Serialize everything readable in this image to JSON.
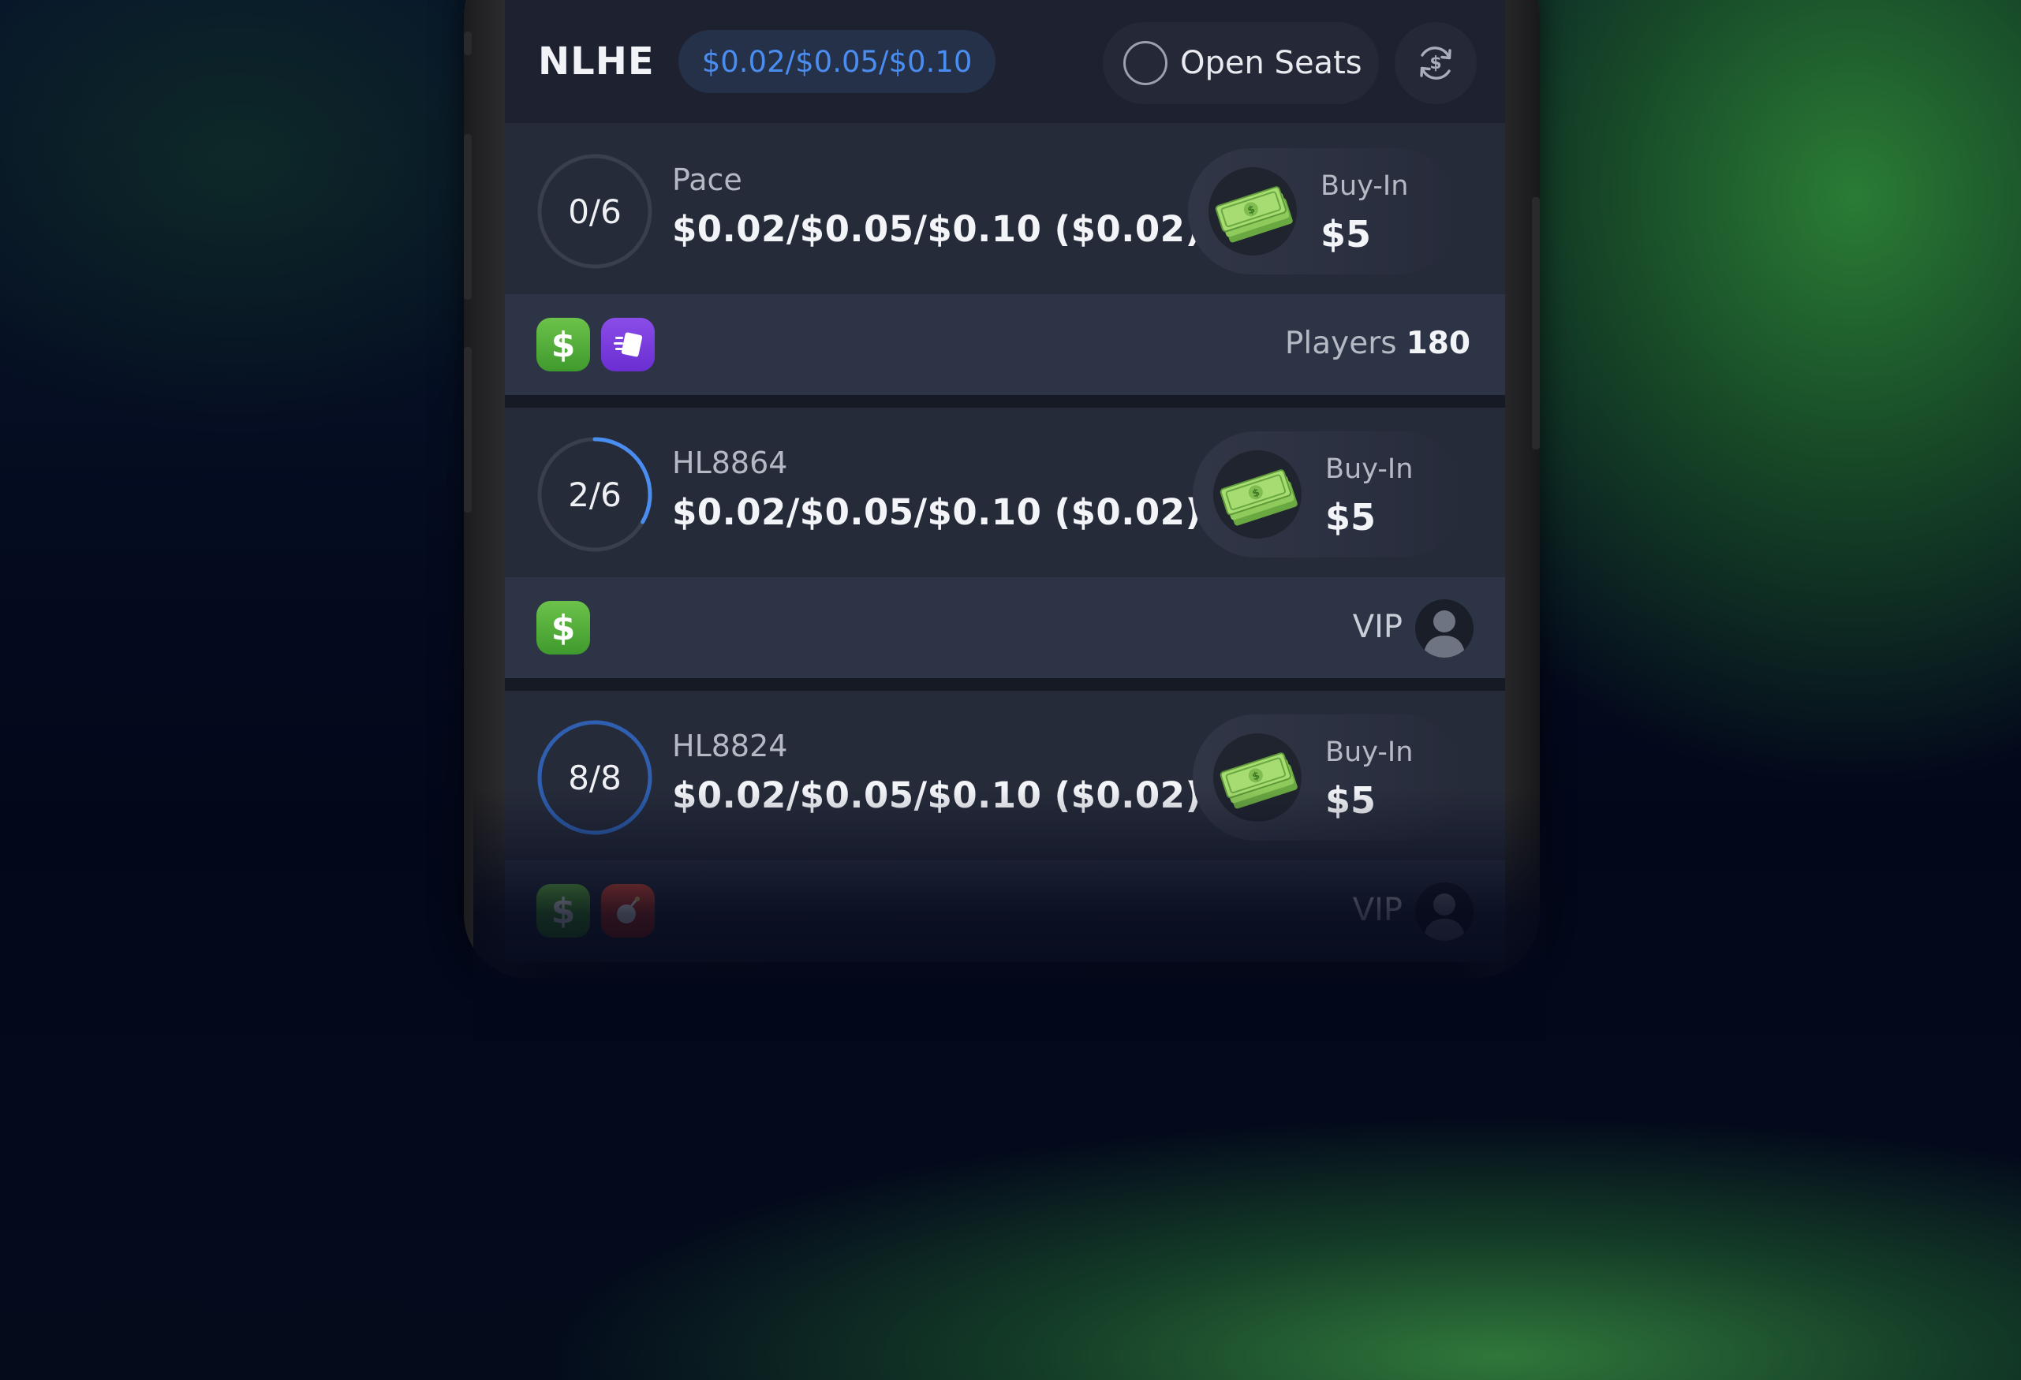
{
  "header": {
    "game": "NLHE",
    "stakes": "$0.02/$0.05/$0.10",
    "open_seats_label": "Open Seats",
    "currency_icon": "dollar-refresh-icon"
  },
  "tables": [
    {
      "seats": "0/6",
      "seat_fill": 0,
      "name": "Pace",
      "stakes": "$0.02/$0.05/$0.10 ($0.02)",
      "buyin_label": "Buy-In",
      "buyin_value": "$5",
      "badges": [
        "cash-badge-icon",
        "fast-fold-icon"
      ],
      "players_label": "Players",
      "players_count": "180"
    },
    {
      "seats": "2/6",
      "seat_fill": 0.333,
      "name": "HL8864",
      "stakes": "$0.02/$0.05/$0.10 ($0.02)",
      "buyin_label": "Buy-In",
      "buyin_value": "$5",
      "badges": [
        "cash-badge-icon"
      ],
      "vip_label": "VIP"
    },
    {
      "seats": "8/8",
      "seat_fill": 1,
      "name": "HL8824",
      "stakes": "$0.02/$0.05/$0.10 ($0.02)",
      "buyin_label": "Buy-In",
      "buyin_value": "$5",
      "badges": [
        "cash-badge-icon",
        "bomb-pot-icon"
      ],
      "vip_label": "VIP"
    }
  ],
  "colors": {
    "accent_blue": "#4a8df1",
    "seat_ring_track": "#3a3f4d",
    "cash_green": "#6cc24a",
    "fastfold_purple": "#7b3fe0",
    "bomb_red": "#d0452f"
  }
}
